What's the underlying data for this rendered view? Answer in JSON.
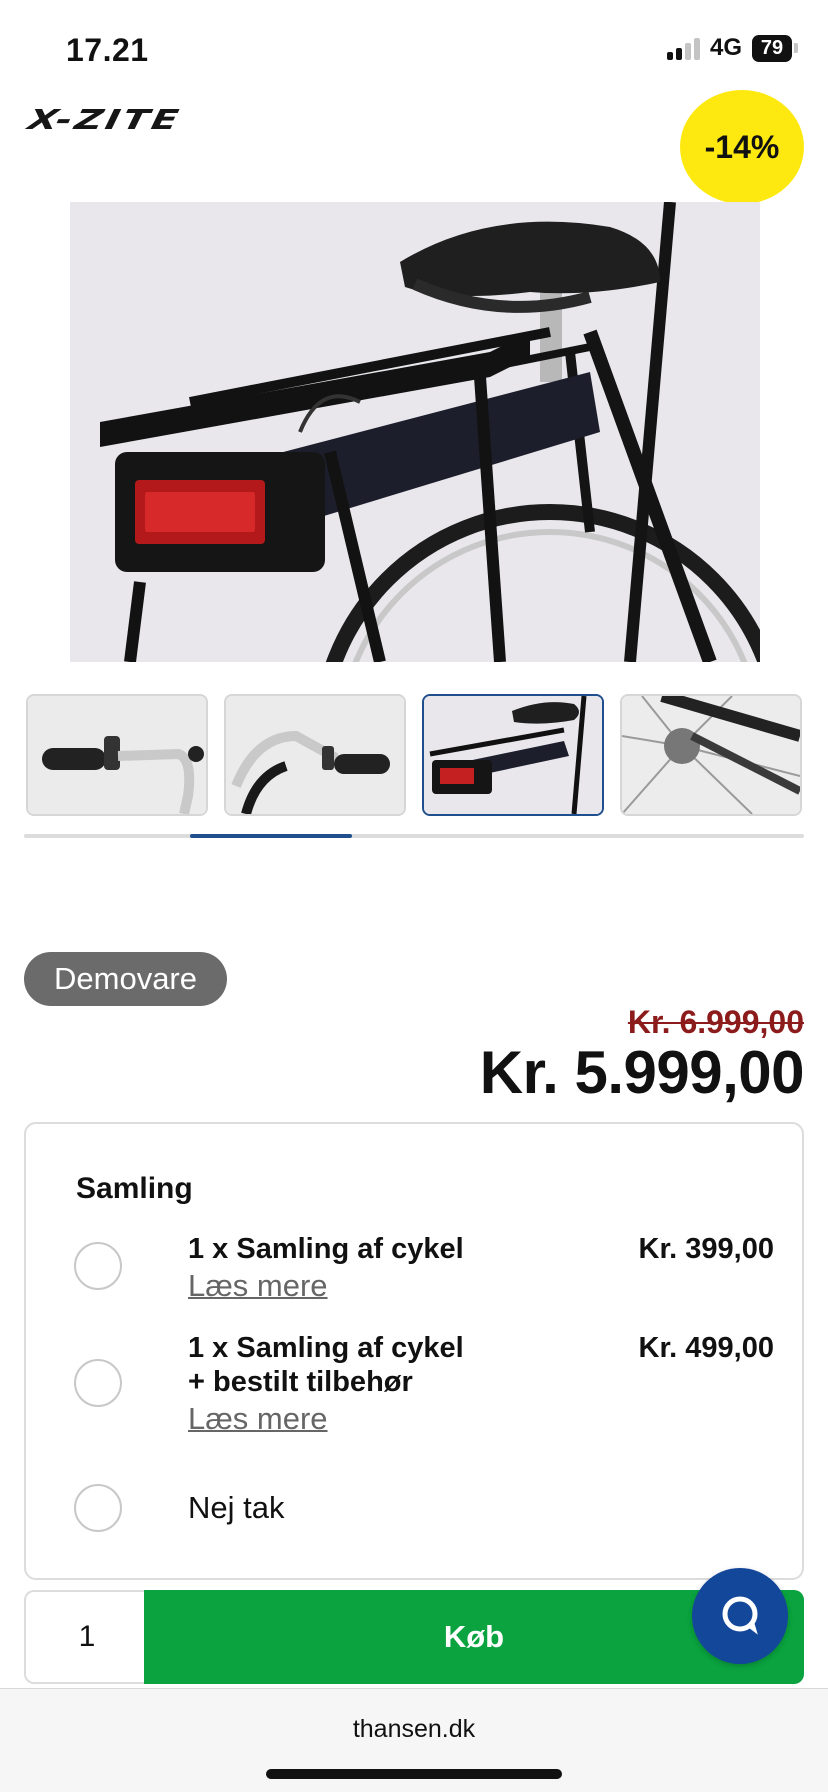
{
  "status_bar": {
    "time": "17.21",
    "network": "4G",
    "battery": "79"
  },
  "brand": {
    "logo_text": "X-ZITE"
  },
  "product": {
    "discount_badge": "-14%",
    "badge_color": "#fde910",
    "thumbnails": [
      {
        "name": "handlebar-left"
      },
      {
        "name": "handlebar-right"
      },
      {
        "name": "rear-rack-battery",
        "active": true
      },
      {
        "name": "rear-hub"
      }
    ],
    "demo_label": "Demovare",
    "old_price": "Kr. 6.999,00",
    "price": "Kr. 5.999,00"
  },
  "assembly": {
    "title": "Samling",
    "options": [
      {
        "label_line1": "1 x Samling af cykel",
        "label_line2": "",
        "price": "Kr. 399,00",
        "link": "Læs mere"
      },
      {
        "label_line1": "1 x Samling af cykel",
        "label_line2": "+ bestilt tilbehør",
        "price": "Kr. 499,00",
        "link": "Læs mere"
      },
      {
        "label_line1": "Nej tak"
      }
    ]
  },
  "purchase": {
    "quantity": "1",
    "buy_label": "Køb",
    "buy_color": "#0aa33f"
  },
  "browser": {
    "url": "thansen.dk"
  }
}
